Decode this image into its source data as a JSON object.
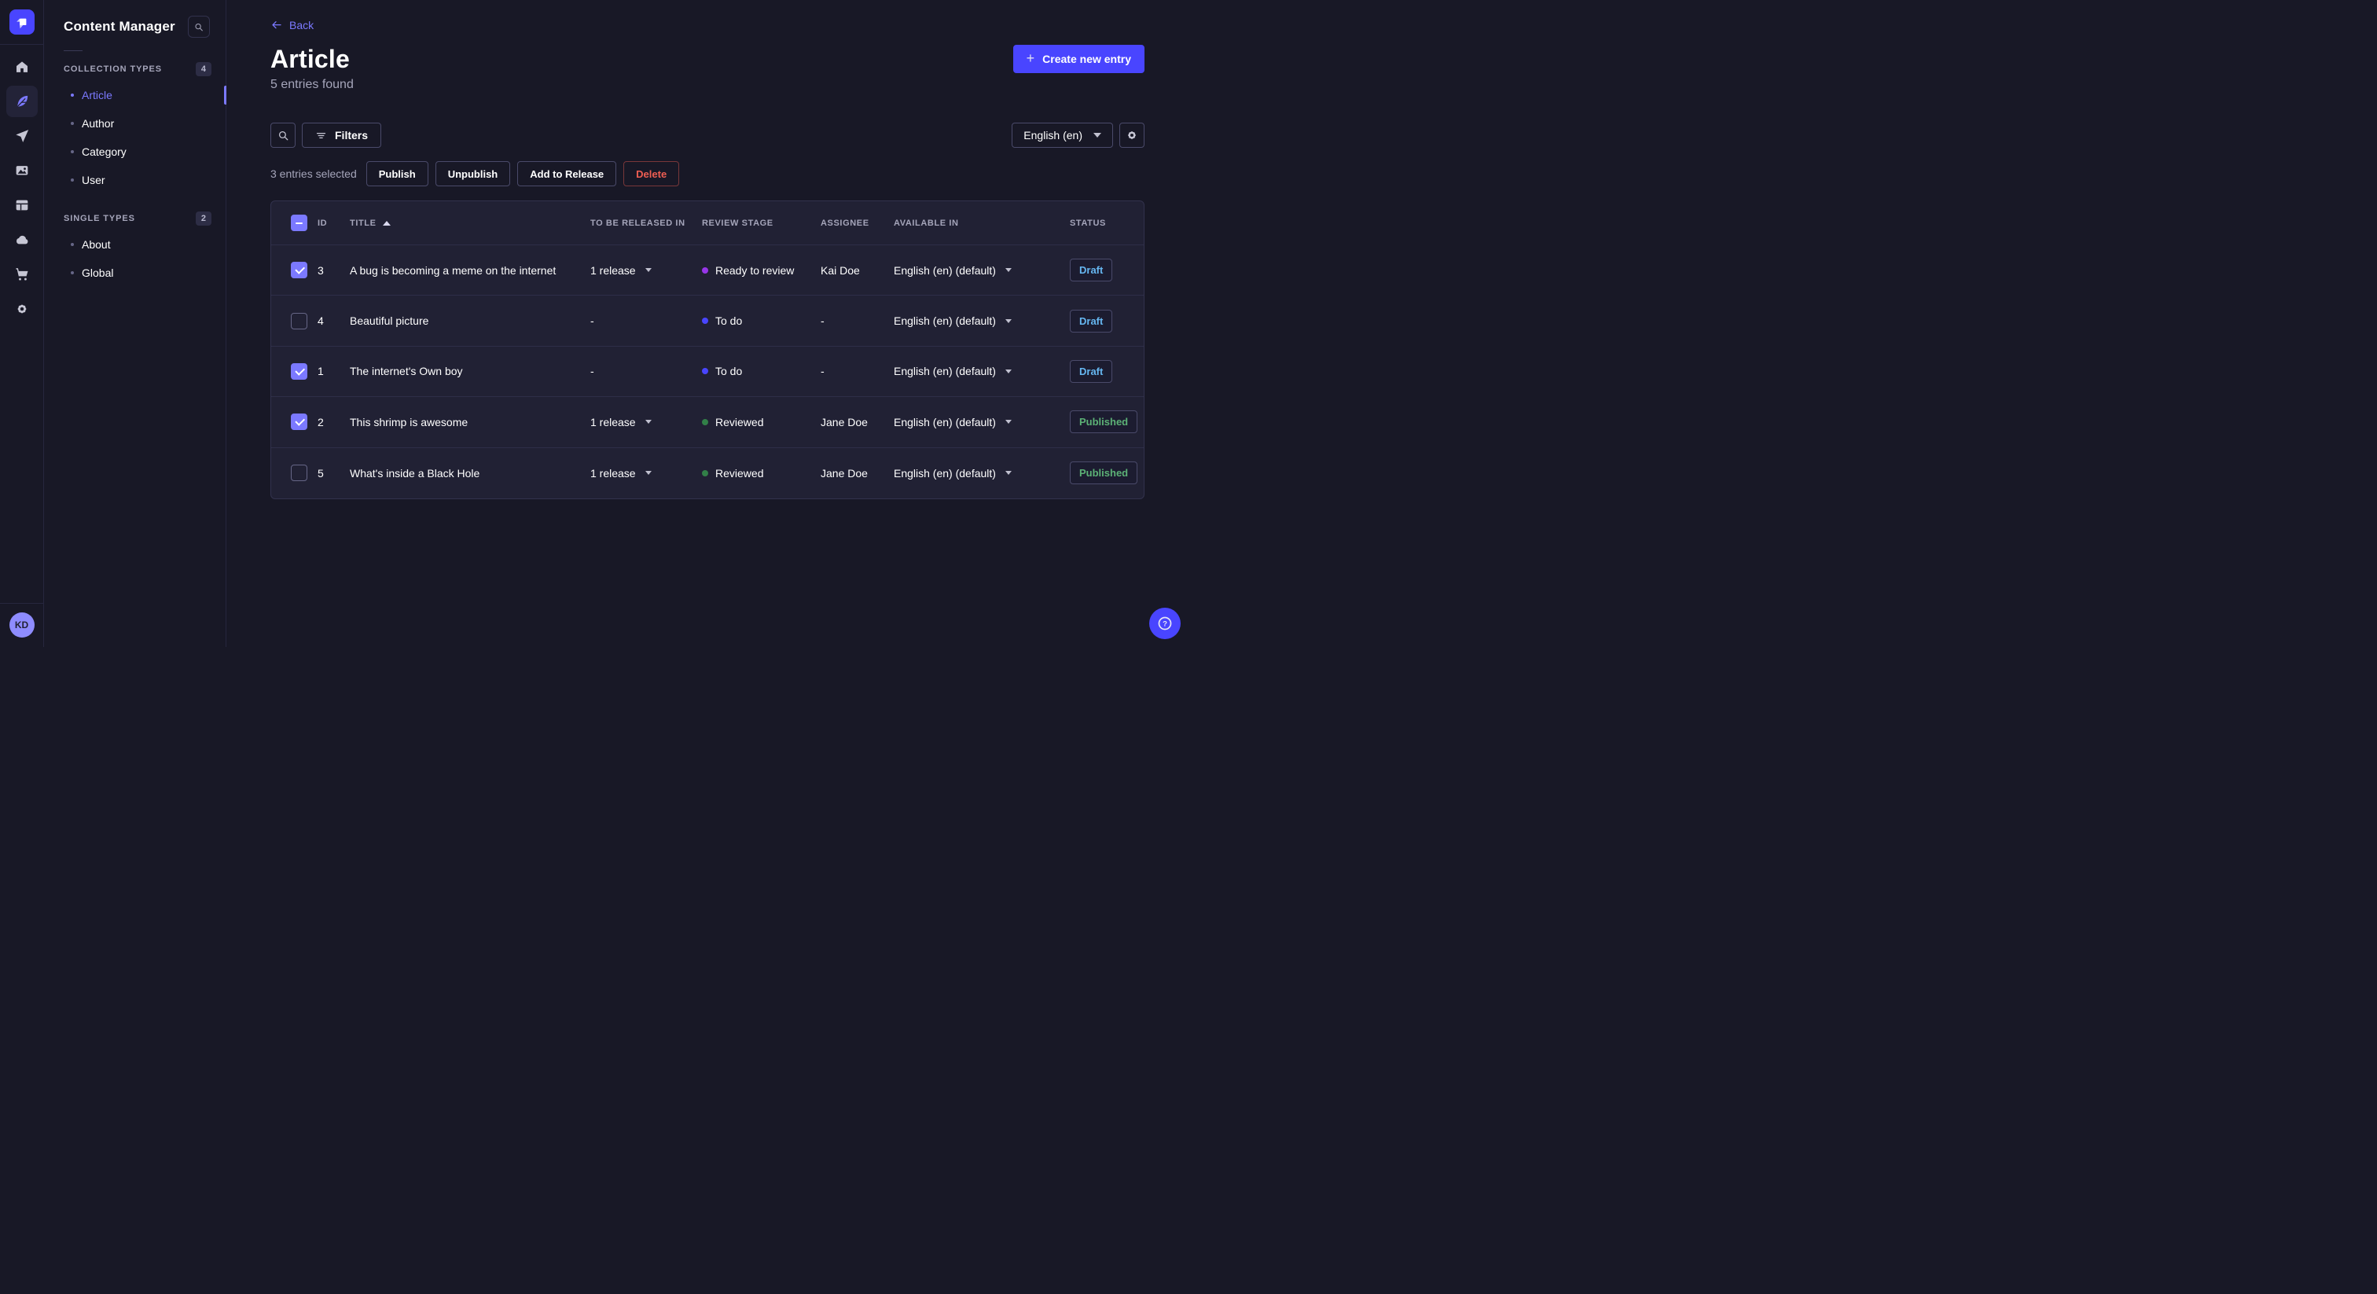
{
  "app": {
    "name": "Strapi admin",
    "theme": "dark"
  },
  "colors": {
    "brand": "#4945ff",
    "accent": "#7b79ff",
    "page_bg": "#181826",
    "panel_bg": "#212134",
    "border": "#32324d",
    "muted_text": "#a5a5ba",
    "draft_status": "#66b7f1",
    "published_status": "#5cb176",
    "danger": "#ee5e52",
    "stage_todo": "#4945ff",
    "stage_ready_to_review": "#9736e8",
    "stage_reviewed": "#328048"
  },
  "rail": {
    "logo_icon": "strapi-logo",
    "items": [
      {
        "icon": "home-icon",
        "active": false
      },
      {
        "icon": "content-manager-feather-icon",
        "active": true
      },
      {
        "icon": "paper-plane-icon",
        "active": false
      },
      {
        "icon": "media-library-icon",
        "active": false
      },
      {
        "icon": "content-type-builder-icon",
        "active": false
      },
      {
        "icon": "cloud-icon",
        "active": false
      },
      {
        "icon": "marketplace-cart-icon",
        "active": false
      },
      {
        "icon": "settings-gear-icon",
        "active": false
      }
    ],
    "avatar_initials": "KD"
  },
  "sidebar": {
    "title": "Content Manager",
    "search_icon": "search-icon",
    "sections": [
      {
        "label": "COLLECTION TYPES",
        "count": "4",
        "items": [
          {
            "label": "Article",
            "active": true
          },
          {
            "label": "Author",
            "active": false
          },
          {
            "label": "Category",
            "active": false
          },
          {
            "label": "User",
            "active": false
          }
        ]
      },
      {
        "label": "SINGLE TYPES",
        "count": "2",
        "items": [
          {
            "label": "About",
            "active": false
          },
          {
            "label": "Global",
            "active": false
          }
        ]
      }
    ]
  },
  "header": {
    "back_label": "Back",
    "title": "Article",
    "subtitle": "5 entries found",
    "create_button_label": "Create new entry"
  },
  "toolbar": {
    "search_icon": "search-icon",
    "filters_label": "Filters",
    "locale_selected": "English (en)",
    "settings_icon": "gear-icon"
  },
  "selection": {
    "summary": "3 entries selected",
    "publish_label": "Publish",
    "unpublish_label": "Unpublish",
    "add_to_release_label": "Add to Release",
    "delete_label": "Delete"
  },
  "table": {
    "header_checkbox_state": "indeterminate",
    "sort": {
      "column": "TITLE",
      "direction": "asc"
    },
    "columns": [
      "ID",
      "TITLE",
      "TO BE RELEASED IN",
      "REVIEW STAGE",
      "ASSIGNEE",
      "AVAILABLE IN",
      "STATUS"
    ],
    "rows": [
      {
        "checked": true,
        "id": "3",
        "title": "A bug is becoming a meme on the internet",
        "to_be_released_in": "1 release",
        "review_stage": {
          "label": "Ready to review",
          "color": "#9736e8"
        },
        "assignee": "Kai Doe",
        "available_in": "English (en) (default)",
        "status": "Draft"
      },
      {
        "checked": false,
        "id": "4",
        "title": "Beautiful picture",
        "to_be_released_in": "-",
        "review_stage": {
          "label": "To do",
          "color": "#4945ff"
        },
        "assignee": "-",
        "available_in": "English (en) (default)",
        "status": "Draft"
      },
      {
        "checked": true,
        "id": "1",
        "title": "The internet's Own boy",
        "to_be_released_in": "-",
        "review_stage": {
          "label": "To do",
          "color": "#4945ff"
        },
        "assignee": "-",
        "available_in": "English (en) (default)",
        "status": "Draft"
      },
      {
        "checked": true,
        "id": "2",
        "title": "This shrimp is awesome",
        "to_be_released_in": "1 release",
        "review_stage": {
          "label": "Reviewed",
          "color": "#328048"
        },
        "assignee": "Jane Doe",
        "available_in": "English (en) (default)",
        "status": "Published"
      },
      {
        "checked": false,
        "id": "5",
        "title": "What's inside a Black Hole",
        "to_be_released_in": "1 release",
        "review_stage": {
          "label": "Reviewed",
          "color": "#328048"
        },
        "assignee": "Jane Doe",
        "available_in": "English (en) (default)",
        "status": "Published"
      }
    ]
  },
  "help": {
    "icon": "question-mark-icon"
  }
}
